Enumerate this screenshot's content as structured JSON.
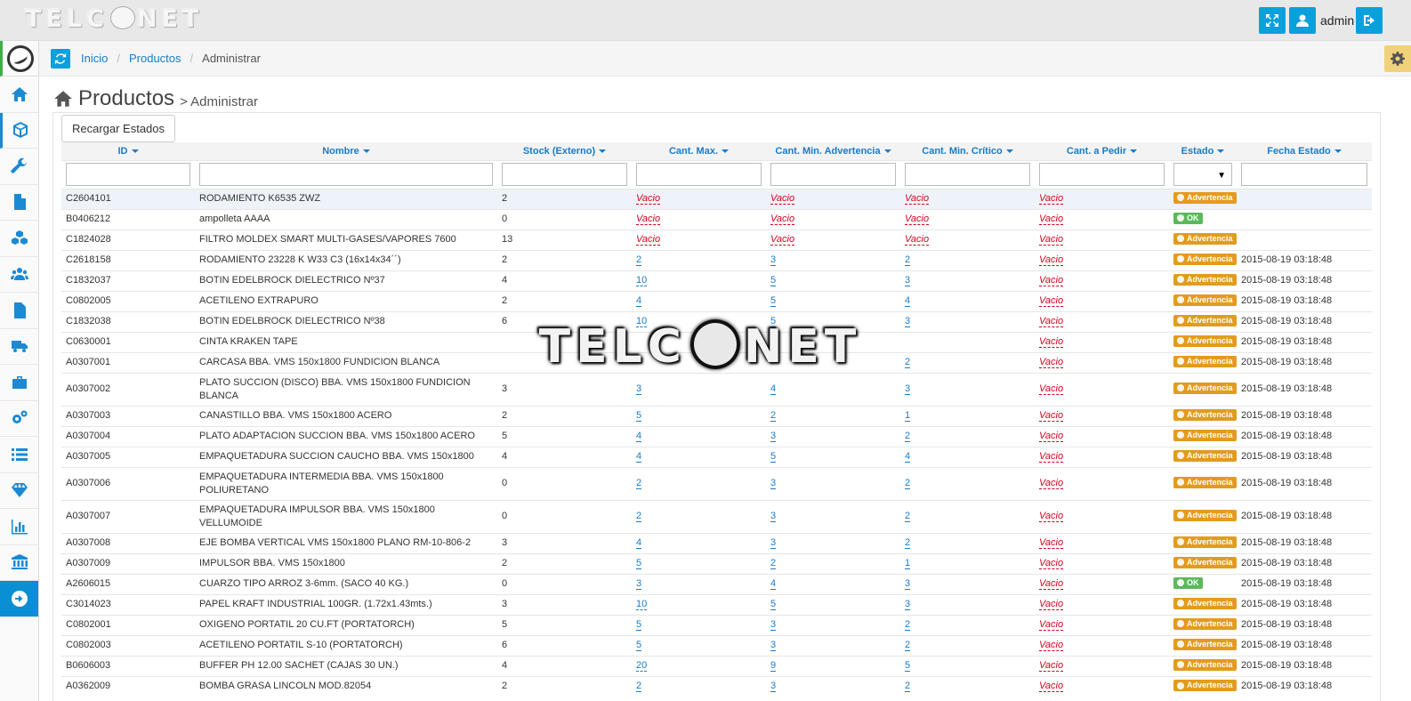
{
  "app": {
    "logo_left": "TELC",
    "logo_right": "NET",
    "user": "admin"
  },
  "breadcrumb": [
    "Inicio",
    "Productos",
    "Administrar"
  ],
  "page": {
    "title": "Productos",
    "subtitle": "> Administrar",
    "reload_button": "Recargar Estados"
  },
  "columns": [
    "ID",
    "Nombre",
    "Stock (Externo)",
    "Cant. Max.",
    "Cant. Min. Advertencia",
    "Cant. Min. Crítico",
    "Cant. a Pedir",
    "Estado",
    "Fecha Estado"
  ],
  "colors": {
    "accent": "#0aa0dc",
    "link": "#1a7bc6",
    "empty": "#d0021b",
    "warning": "#e39b1e",
    "ok": "#5cb85c"
  },
  "status_labels": {
    "warn": "Advertencia",
    "ok": "OK"
  },
  "rows": [
    {
      "id": "C2604101",
      "nombre": "RODAMIENTO K6535 ZWZ",
      "stock": "2",
      "max": "Vacio",
      "adv": "Vacio",
      "crit": "Vacio",
      "pedir": "Vacio",
      "estado": "Advertencia",
      "fecha": ""
    },
    {
      "id": "B0406212",
      "nombre": "ampolleta AAAA",
      "stock": "0",
      "max": "Vacio",
      "adv": "Vacio",
      "crit": "Vacio",
      "pedir": "Vacio",
      "estado": "OK",
      "fecha": ""
    },
    {
      "id": "C1824028",
      "nombre": "FILTRO MOLDEX SMART MULTI-GASES/VAPORES 7600",
      "stock": "13",
      "max": "Vacio",
      "adv": "Vacio",
      "crit": "Vacio",
      "pedir": "Vacio",
      "estado": "Advertencia",
      "fecha": ""
    },
    {
      "id": "C2618158",
      "nombre": "RODAMIENTO 23228 K W33 C3 (16x14x34´´)",
      "stock": "2",
      "max": "2",
      "adv": "3",
      "crit": "2",
      "pedir": "Vacio",
      "estado": "Advertencia",
      "fecha": "2015-08-19 03:18:48"
    },
    {
      "id": "C1832037",
      "nombre": "BOTIN EDELBROCK DIELECTRICO Nº37",
      "stock": "4",
      "max": "10",
      "adv": "5",
      "crit": "3",
      "pedir": "Vacio",
      "estado": "Advertencia",
      "fecha": "2015-08-19 03:18:48"
    },
    {
      "id": "C0802005",
      "nombre": "ACETILENO EXTRAPURO",
      "stock": "2",
      "max": "4",
      "adv": "5",
      "crit": "4",
      "pedir": "Vacio",
      "estado": "Advertencia",
      "fecha": "2015-08-19 03:18:48"
    },
    {
      "id": "C1832038",
      "nombre": "BOTIN EDELBROCK DIELECTRICO Nº38",
      "stock": "6",
      "max": "10",
      "adv": "5",
      "crit": "3",
      "pedir": "Vacio",
      "estado": "Advertencia",
      "fecha": "2015-08-19 03:18:48"
    },
    {
      "id": "C0630001",
      "nombre": "CINTA KRAKEN TAPE",
      "stock": "",
      "max": "",
      "adv": "",
      "crit": "",
      "pedir": "Vacio",
      "estado": "Advertencia",
      "fecha": "2015-08-19 03:18:48"
    },
    {
      "id": "A0307001",
      "nombre": "CARCASA BBA. VMS 150x1800 FUNDICION BLANCA",
      "stock": "",
      "max": "",
      "adv": "",
      "crit": "2",
      "pedir": "Vacio",
      "estado": "Advertencia",
      "fecha": "2015-08-19 03:18:48"
    },
    {
      "id": "A0307002",
      "nombre": "PLATO SUCCION (DISCO) BBA. VMS 150x1800 FUNDICION BLANCA",
      "stock": "3",
      "max": "3",
      "adv": "4",
      "crit": "3",
      "pedir": "Vacio",
      "estado": "Advertencia",
      "fecha": "2015-08-19 03:18:48",
      "tall": true
    },
    {
      "id": "A0307003",
      "nombre": "CANASTILLO BBA. VMS 150x1800 ACERO",
      "stock": "2",
      "max": "5",
      "adv": "2",
      "crit": "1",
      "pedir": "Vacio",
      "estado": "Advertencia",
      "fecha": "2015-08-19 03:18:48"
    },
    {
      "id": "A0307004",
      "nombre": "PLATO ADAPTACION SUCCION BBA. VMS 150x1800 ACERO",
      "stock": "5",
      "max": "4",
      "adv": "3",
      "crit": "2",
      "pedir": "Vacio",
      "estado": "Advertencia",
      "fecha": "2015-08-19 03:18:48"
    },
    {
      "id": "A0307005",
      "nombre": "EMPAQUETADURA SUCCION CAUCHO BBA. VMS 150x1800",
      "stock": "4",
      "max": "4",
      "adv": "5",
      "crit": "4",
      "pedir": "Vacio",
      "estado": "Advertencia",
      "fecha": "2015-08-19 03:18:48"
    },
    {
      "id": "A0307006",
      "nombre": "EMPAQUETADURA INTERMEDIA BBA. VMS 150x1800 POLIURETANO",
      "stock": "0",
      "max": "2",
      "adv": "3",
      "crit": "2",
      "pedir": "Vacio",
      "estado": "Advertencia",
      "fecha": "2015-08-19 03:18:48",
      "tall": true
    },
    {
      "id": "A0307007",
      "nombre": "EMPAQUETADURA IMPULSOR BBA. VMS 150x1800 VELLUMOIDE",
      "stock": "0",
      "max": "2",
      "adv": "3",
      "crit": "2",
      "pedir": "Vacio",
      "estado": "Advertencia",
      "fecha": "2015-08-19 03:18:48",
      "tall": true
    },
    {
      "id": "A0307008",
      "nombre": "EJE BOMBA VERTICAL VMS 150x1800 PLANO RM-10-806-2",
      "stock": "3",
      "max": "4",
      "adv": "3",
      "crit": "2",
      "pedir": "Vacio",
      "estado": "Advertencia",
      "fecha": "2015-08-19 03:18:48"
    },
    {
      "id": "A0307009",
      "nombre": "IMPULSOR BBA. VMS 150x1800",
      "stock": "2",
      "max": "5",
      "adv": "2",
      "crit": "1",
      "pedir": "Vacio",
      "estado": "Advertencia",
      "fecha": "2015-08-19 03:18:48"
    },
    {
      "id": "A2606015",
      "nombre": "CUARZO TIPO ARROZ 3-6mm. (SACO 40 KG.)",
      "stock": "0",
      "max": "3",
      "adv": "4",
      "crit": "3",
      "pedir": "Vacio",
      "estado": "OK",
      "fecha": "2015-08-19 03:18:48"
    },
    {
      "id": "C3014023",
      "nombre": "PAPEL KRAFT INDUSTRIAL 100GR. (1.72x1.43mts.)",
      "stock": "3",
      "max": "10",
      "adv": "5",
      "crit": "3",
      "pedir": "Vacio",
      "estado": "Advertencia",
      "fecha": "2015-08-19 03:18:48"
    },
    {
      "id": "C0802001",
      "nombre": "OXIGENO PORTATIL 20 CU.FT (PORTATORCH)",
      "stock": "5",
      "max": "5",
      "adv": "3",
      "crit": "2",
      "pedir": "Vacio",
      "estado": "Advertencia",
      "fecha": "2015-08-19 03:18:48"
    },
    {
      "id": "C0802003",
      "nombre": "ACETILENO PORTATIL S-10 (PORTATORCH)",
      "stock": "6",
      "max": "5",
      "adv": "3",
      "crit": "2",
      "pedir": "Vacio",
      "estado": "Advertencia",
      "fecha": "2015-08-19 03:18:48"
    },
    {
      "id": "B0606003",
      "nombre": "BUFFER PH 12.00 SACHET (CAJAS 30 UN.)",
      "stock": "4",
      "max": "20",
      "adv": "9",
      "crit": "5",
      "pedir": "Vacio",
      "estado": "Advertencia",
      "fecha": "2015-08-19 03:18:48"
    },
    {
      "id": "A0362009",
      "nombre": "BOMBA GRASA LINCOLN MOD.82054",
      "stock": "2",
      "max": "2",
      "adv": "3",
      "crit": "2",
      "pedir": "Vacio",
      "estado": "Advertencia",
      "fecha": "2015-08-19 03:18:48"
    }
  ],
  "icons": {
    "topbar": [
      "expand-icon",
      "user-icon",
      "logout-icon"
    ],
    "sidebar": [
      "home-icon",
      "cube-icon",
      "wrench-icon",
      "document-icon",
      "cubes-icon",
      "users-icon",
      "file-text-icon",
      "truck-icon",
      "briefcase-icon",
      "cogs-icon",
      "list-icon",
      "diamond-icon",
      "bar-chart-icon",
      "bank-icon",
      "arrow-right-circle-icon"
    ]
  }
}
